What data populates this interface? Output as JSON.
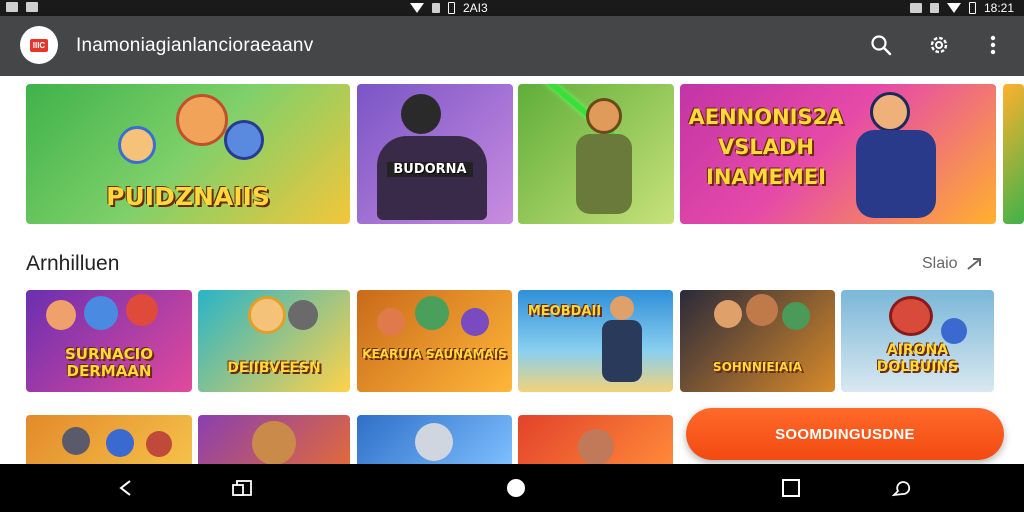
{
  "status_bar": {
    "center_time": "2AI3",
    "right_time": "18:21"
  },
  "app_bar": {
    "logo_text": "IIIC",
    "title": "Inamoniagianlancioraeaanv",
    "icons": [
      "search-icon",
      "settings-icon",
      "more-vert-icon"
    ]
  },
  "featured": [
    {
      "label": "PUIDZNAIIS",
      "bg": [
        "#3fb24a",
        "#f3c63a"
      ]
    },
    {
      "label": "BUDORNA",
      "bg": [
        "#7a55c6",
        "#c98de0"
      ]
    },
    {
      "label": "",
      "bg": [
        "#5fae3a",
        "#c8e27a"
      ]
    },
    {
      "label": "AENNONIS2A VSLADH INAMEMEI",
      "bg": [
        "#c234a6",
        "#ffb12e"
      ]
    }
  ],
  "section": {
    "title": "Arnhilluen",
    "see_all": "Slaio"
  },
  "games": [
    {
      "label": "SURNACIO DERMAAN",
      "bg": [
        "#6b2fb0",
        "#e24a9c"
      ]
    },
    {
      "label": "DEIIBVEESN",
      "bg": [
        "#28b4c9",
        "#ffd24a"
      ]
    },
    {
      "label": "KEARUIA SAUNAMAIS",
      "bg": [
        "#c96a1a",
        "#ffb73a"
      ]
    },
    {
      "label": "MEOBDAII",
      "bg": [
        "#2f8fd8",
        "#f2d27a"
      ]
    },
    {
      "label": "SOHNNIEIAIA",
      "bg": [
        "#2a2a3a",
        "#d88a2a"
      ]
    },
    {
      "label": "AIRONA DOLBUINS",
      "bg": [
        "#7ab7d8",
        "#d9e8f0"
      ]
    }
  ],
  "bottom_row": [
    {
      "bg": [
        "#e38a2a",
        "#f5c24a"
      ]
    },
    {
      "bg": [
        "#8a3fb0",
        "#e26a3a"
      ]
    },
    {
      "bg": [
        "#2f6fc8",
        "#7ec0ff"
      ]
    },
    {
      "bg": [
        "#e2432a",
        "#ff8a3a"
      ]
    }
  ],
  "fab": {
    "label": "SOOMDINGUSDNE"
  },
  "nav_bar": [
    "back-icon",
    "recents-icon",
    "home-icon",
    "overview-icon",
    "assistant-icon"
  ]
}
